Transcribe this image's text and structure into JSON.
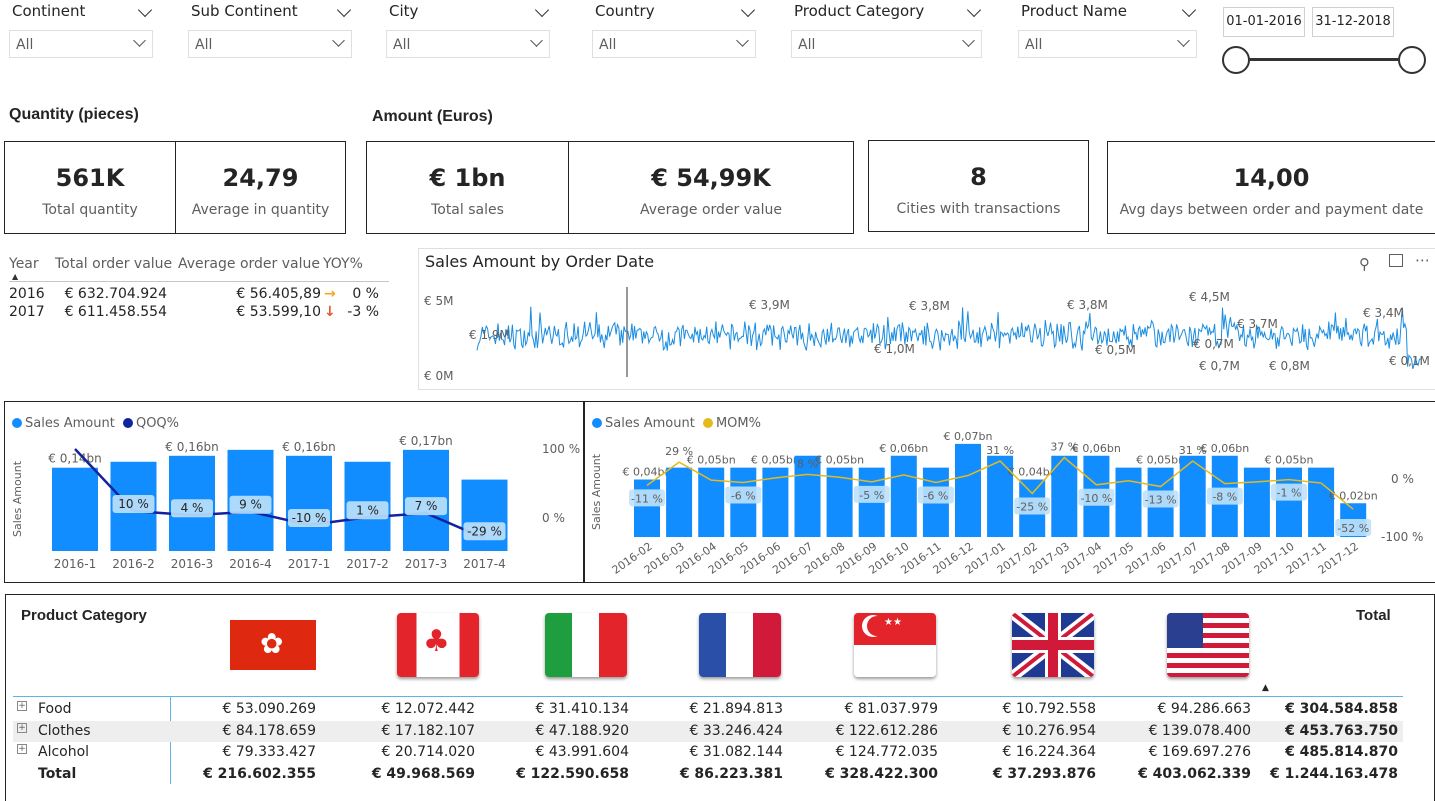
{
  "slicers": [
    {
      "title": "Continent",
      "value": "All"
    },
    {
      "title": "Sub Continent",
      "value": "All"
    },
    {
      "title": "City",
      "value": "All"
    },
    {
      "title": "Country",
      "value": "All"
    },
    {
      "title": "Product Category",
      "value": "All"
    },
    {
      "title": "Product Name",
      "value": "All"
    }
  ],
  "date_range": {
    "start": "01-01-2016",
    "end": "31-12-2018"
  },
  "sections": {
    "quantity": "Quantity (pieces)",
    "amount": "Amount (Euros)"
  },
  "cards": [
    {
      "value": "561K",
      "label": "Total quantity"
    },
    {
      "value": "24,79",
      "label": "Average in quantity"
    },
    {
      "value": "€ 1bn",
      "label": "Total sales"
    },
    {
      "value": "€ 54,99K",
      "label": "Average order value"
    },
    {
      "value": "8",
      "label": "Cities with transactions"
    },
    {
      "value": "14,00",
      "label": "Avg days between order and payment date"
    }
  ],
  "yoy_table": {
    "headers": [
      "Year",
      "Total order value",
      "Average order value",
      "YOY%"
    ],
    "rows": [
      {
        "year": "2016",
        "total": "€ 632.704.924",
        "avg": "€ 56.405,89",
        "yoy": "0 %",
        "arrow": "→"
      },
      {
        "year": "2017",
        "total": "€ 611.458.554",
        "avg": "€ 53.599,10",
        "yoy": "-3 %",
        "arrow": "↓"
      }
    ]
  },
  "colors": {
    "blue": "#118DFF",
    "navy": "#12239E",
    "gold": "#E5BA1E",
    "orange": "#F5A623",
    "red": "#E8562A",
    "line": "#1B8DE0"
  },
  "line_chart": {
    "title": "Sales Amount by Order Date",
    "y_ticks": [
      "€ 5M",
      "€ 0M"
    ],
    "labels": [
      "€ 1,9M",
      "€ 3,9M",
      "€ 3,8M",
      "€ 3,8M",
      "€ 4,5M",
      "€ 3,7M",
      "€ 3,4M",
      "€ 1,0M",
      "€ 0,5M",
      "€ 0,7M",
      "€ 0,7M",
      "€ 0,8M",
      "€ 0,1M"
    ]
  },
  "chart_data": [
    {
      "type": "bar",
      "legend": [
        "Sales Amount",
        "QOQ%"
      ],
      "ylabel": "Sales Amount",
      "categories": [
        "2016-1",
        "2016-2",
        "2016-3",
        "2016-4",
        "2017-1",
        "2017-2",
        "2017-3",
        "2017-4"
      ],
      "series": [
        {
          "name": "Sales Amount",
          "values": [
            0.14,
            0.15,
            0.16,
            0.17,
            0.16,
            0.15,
            0.17,
            0.12
          ]
        },
        {
          "name": "QOQ%",
          "values": [
            null,
            10,
            4,
            9,
            -10,
            1,
            7,
            -29
          ]
        }
      ],
      "bar_labels": [
        "€ 0,14bn",
        "",
        "€ 0,16bn",
        "",
        "€ 0,16bn",
        "",
        "€ 0,17bn",
        ""
      ],
      "pct_labels": [
        "",
        "10 %",
        "4 %",
        "9 %",
        "-10 %",
        "1 %",
        "7 %",
        "-29 %"
      ],
      "y2_ticks": [
        "100 %",
        "0 %"
      ]
    },
    {
      "type": "bar",
      "legend": [
        "Sales Amount",
        "MOM%"
      ],
      "ylabel": "Sales Amount",
      "categories": [
        "2016-02",
        "2016-03",
        "2016-04",
        "2016-05",
        "2016-06",
        "2016-07",
        "2016-08",
        "2016-09",
        "2016-10",
        "2016-11",
        "2016-12",
        "2017-01",
        "2017-02",
        "2017-03",
        "2017-04",
        "2017-05",
        "2017-06",
        "2017-07",
        "2017-08",
        "2017-09",
        "2017-10",
        "2017-11",
        "2017-12"
      ],
      "series": [
        {
          "name": "Sales Amount",
          "values": [
            0.04,
            0.05,
            0.05,
            0.05,
            0.05,
            0.06,
            0.05,
            0.05,
            0.06,
            0.05,
            0.07,
            0.06,
            0.04,
            0.06,
            0.06,
            0.05,
            0.05,
            0.06,
            0.06,
            0.05,
            0.05,
            0.05,
            0.02
          ]
        },
        {
          "name": "MOM%",
          "values": [
            -11,
            29,
            -2,
            -6,
            2,
            8,
            3,
            -5,
            7,
            -6,
            6,
            31,
            -25,
            37,
            -10,
            -3,
            -13,
            31,
            -8,
            -5,
            -1,
            -7,
            -52
          ]
        }
      ],
      "bar_labels": [
        "€ 0,04bn",
        "",
        "€ 0,05bn",
        "",
        "€ 0,05bn",
        "",
        "€ 0,05bn",
        "",
        "€ 0,06bn",
        "",
        "€ 0,07bn",
        "",
        "€ 0,04bn",
        "",
        "€ 0,06bn",
        "",
        "€ 0,05bn",
        "",
        "€ 0,06bn",
        "",
        "€ 0,05bn",
        "",
        "€ 0,02bn"
      ],
      "pct_labels": [
        "-11 %",
        "29 %",
        "",
        "-6 %",
        "",
        "8 %",
        "",
        "-5 %",
        "",
        "-6 %",
        "",
        "31 %",
        "-25 %",
        "37 %",
        "-10 %",
        "",
        "-13 %",
        "31 %",
        "-8 %",
        "",
        "-1 %",
        "",
        "-52 %"
      ],
      "y2_ticks": [
        "0 %",
        "-100 %"
      ]
    }
  ],
  "matrix": {
    "header": "Product Category",
    "total_header": "Total",
    "flags": [
      "hong-kong-flag",
      "canada-flag",
      "italy-flag",
      "france-flag",
      "singapore-flag",
      "uk-flag",
      "usa-flag"
    ],
    "rows": [
      {
        "label": "Food",
        "cells": [
          "€ 53.090.269",
          "€ 12.072.442",
          "€ 31.410.134",
          "€ 21.894.813",
          "€ 81.037.979",
          "€ 10.792.558",
          "€ 94.286.663"
        ],
        "total": "€ 304.584.858"
      },
      {
        "label": "Clothes",
        "cells": [
          "€ 84.178.659",
          "€ 17.182.107",
          "€ 47.188.920",
          "€ 33.246.424",
          "€ 122.612.286",
          "€ 10.276.954",
          "€ 139.078.400"
        ],
        "total": "€ 453.763.750"
      },
      {
        "label": "Alcohol",
        "cells": [
          "€ 79.333.427",
          "€ 20.714.020",
          "€ 43.991.604",
          "€ 31.082.144",
          "€ 124.772.035",
          "€ 16.224.364",
          "€ 169.697.276"
        ],
        "total": "€ 485.814.870"
      }
    ],
    "total_row": {
      "label": "Total",
      "cells": [
        "€ 216.602.355",
        "€ 49.968.569",
        "€ 122.590.658",
        "€ 86.223.381",
        "€ 328.422.300",
        "€ 37.293.876",
        "€ 403.062.339"
      ],
      "total": "€ 1.244.163.478"
    }
  }
}
